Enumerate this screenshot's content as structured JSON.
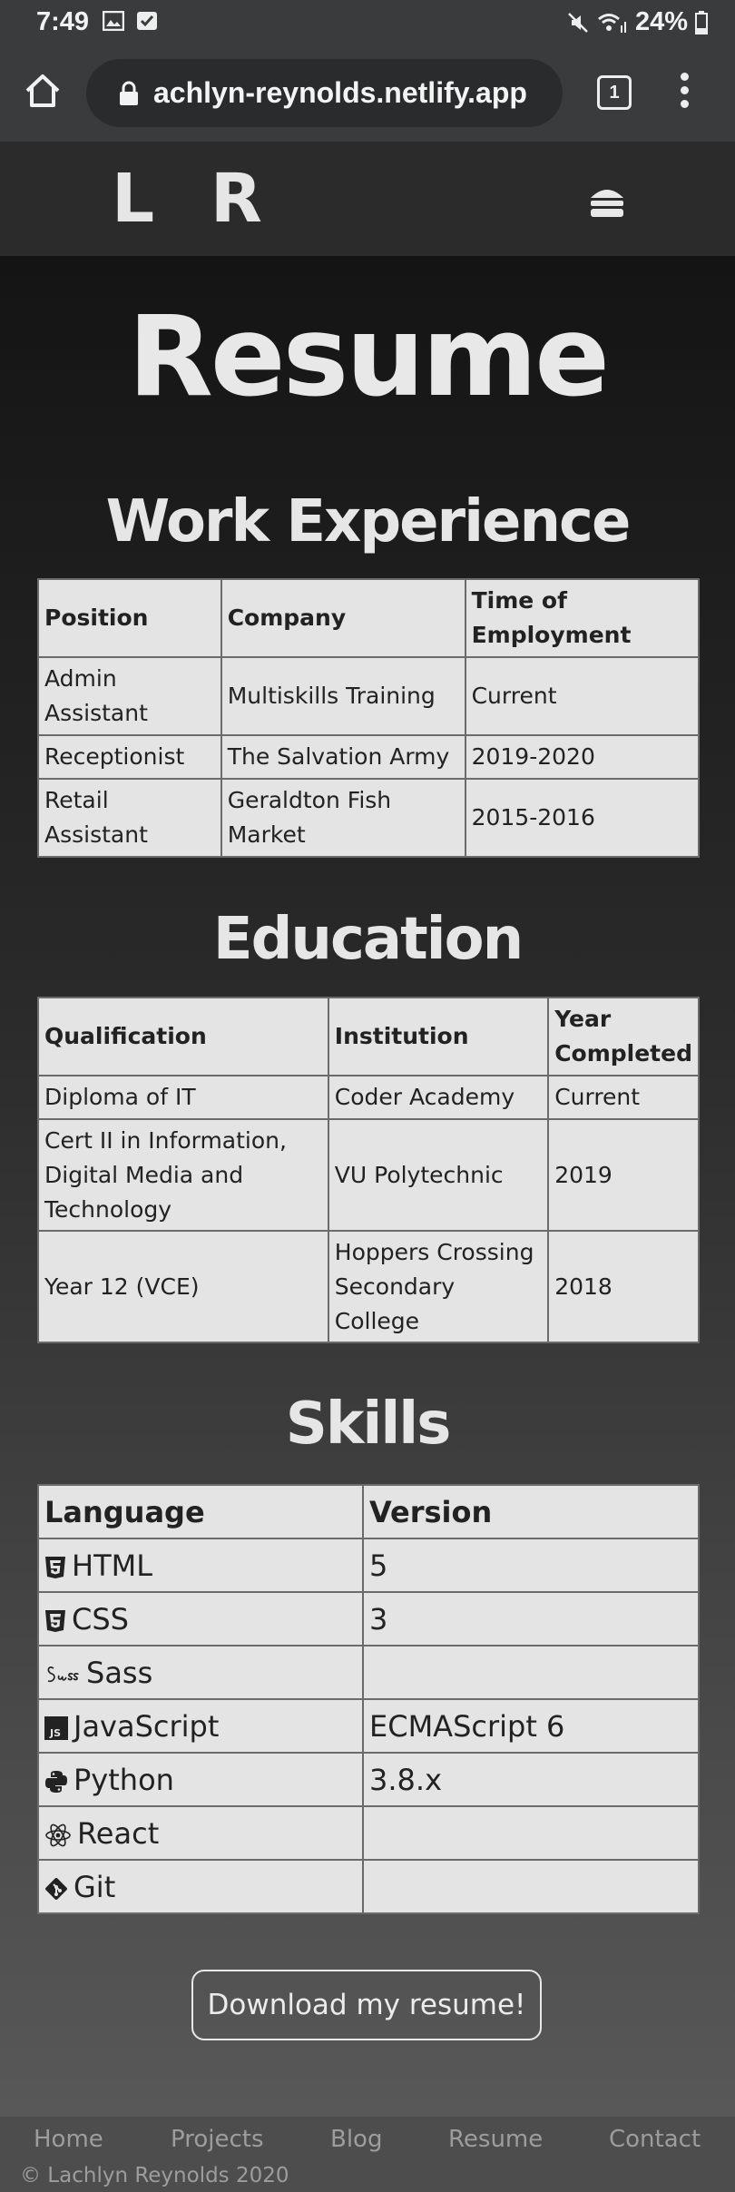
{
  "status": {
    "time": "7:49",
    "battery": "24%"
  },
  "browser": {
    "url": "achlyn-reynolds.netlify.app",
    "tab_count": "1"
  },
  "site": {
    "logo": "L R"
  },
  "page": {
    "title": "Resume"
  },
  "work": {
    "title": "Work Experience",
    "headers": [
      "Position",
      "Company",
      "Time of Employment"
    ],
    "rows": [
      [
        "Admin Assistant",
        "Multiskills Training",
        "Current"
      ],
      [
        "Receptionist",
        "The Salvation Army",
        "2019-2020"
      ],
      [
        "Retail Assistant",
        "Geraldton Fish Market",
        "2015-2016"
      ]
    ]
  },
  "education": {
    "title": "Education",
    "headers": [
      "Qualification",
      "Institution",
      "Year Completed"
    ],
    "rows": [
      [
        "Diploma of IT",
        "Coder Academy",
        "Current"
      ],
      [
        "Cert II in Information, Digital Media and Technology",
        "VU Polytechnic",
        "2019"
      ],
      [
        "Year 12 (VCE)",
        "Hoppers Crossing Secondary College",
        "2018"
      ]
    ]
  },
  "skills": {
    "title": "Skills",
    "headers": [
      "Language",
      "Version"
    ],
    "rows": [
      {
        "icon": "html5-icon",
        "name": "HTML",
        "version": "5"
      },
      {
        "icon": "css3-icon",
        "name": "CSS",
        "version": "3"
      },
      {
        "icon": "sass-icon",
        "name": "Sass",
        "version": ""
      },
      {
        "icon": "javascript-icon",
        "name": "JavaScript",
        "version": "ECMAScript 6"
      },
      {
        "icon": "python-icon",
        "name": "Python",
        "version": "3.8.x"
      },
      {
        "icon": "react-icon",
        "name": "React",
        "version": ""
      },
      {
        "icon": "git-icon",
        "name": "Git",
        "version": ""
      }
    ]
  },
  "download_label": "Download my resume!",
  "footer": {
    "links": [
      "Home",
      "Projects",
      "Blog",
      "Resume",
      "Contact"
    ],
    "copyright": "© Lachlyn Reynolds 2020"
  }
}
